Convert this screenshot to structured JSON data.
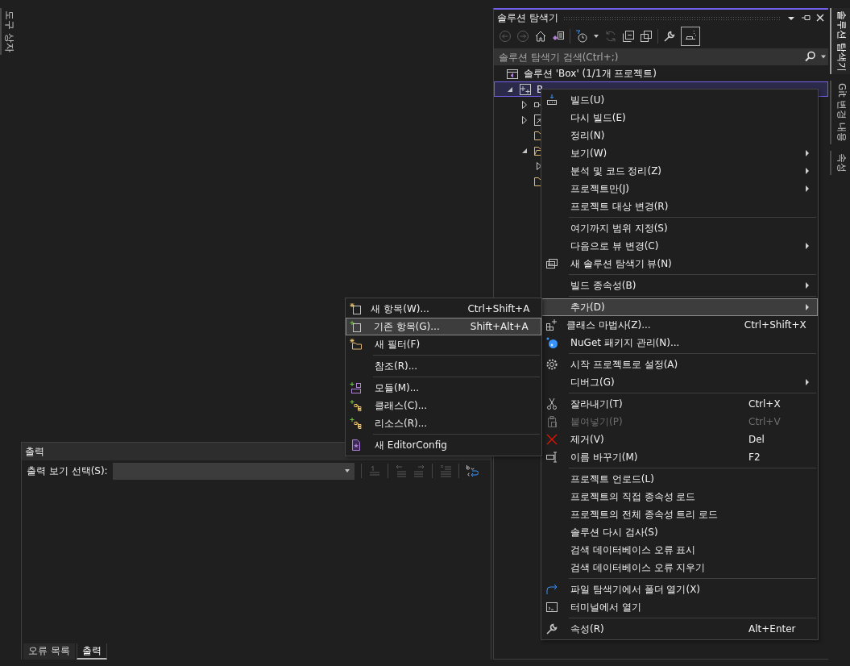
{
  "tool_strip": {
    "tabs": [
      {
        "label": "도구 상자",
        "selected": false
      }
    ]
  },
  "output": {
    "title": "출력",
    "source_label": "출력 보기 선택(S):",
    "toolbar": [
      [
        {
          "disabled": true
        }
      ],
      [
        {
          "disabled": true
        },
        {
          "disabled": true
        }
      ],
      [
        {
          "disabled": true
        }
      ],
      [
        {
          "disabled": false
        }
      ]
    ],
    "tabs": [
      {
        "label": "오류 목록",
        "selected": false
      },
      {
        "label": "출력",
        "selected": true
      }
    ]
  },
  "solution_explorer": {
    "title": "솔루션 탐색기",
    "toolbar": [
      [
        {
          "disabled": true,
          "on": false
        },
        {
          "disabled": true,
          "on": false
        },
        {
          "disabled": false,
          "on": false
        },
        {
          "disabled": false,
          "on": false
        }
      ],
      [
        {
          "disabled": false,
          "on": false
        },
        {
          "disabled": true,
          "on": false
        },
        {
          "disabled": false,
          "on": false
        },
        {
          "disabled": false,
          "on": false
        }
      ],
      [
        {
          "disabled": false,
          "on": false
        },
        {
          "disabled": false,
          "on": true
        }
      ]
    ],
    "search": {
      "placeholder": "솔루션 탐색기 검색(Ctrl+;)"
    },
    "tree": [
      {
        "kind": "solution",
        "label": "솔루션 'Box' (1/1개 프로젝트)",
        "selected": false
      },
      {
        "kind": "project",
        "label": "B",
        "expanded": true,
        "selected": true,
        "children": [
          {
            "kind": "references",
            "expanded": false,
            "selected": false
          },
          {
            "kind": "external",
            "expanded": false,
            "selected": false
          },
          {
            "kind": "folder",
            "selected": false
          },
          {
            "kind": "folder-open",
            "expanded": true,
            "selected": false,
            "children": [
              {
                "expanded": false,
                "selected": false
              }
            ]
          },
          {
            "kind": "folder",
            "selected": false
          }
        ]
      }
    ]
  },
  "side_tabs": [
    {
      "label": "솔루션 탐색기",
      "selected": true
    },
    {
      "label": "Git 변경 내용",
      "selected": false
    },
    {
      "label": "속성",
      "selected": false
    }
  ],
  "context_menu": {
    "groups": [
      [
        {
          "label": "빌드(U)",
          "submenu": false,
          "disabled": false,
          "selected": false
        },
        {
          "label": "다시 빌드(E)",
          "submenu": false,
          "disabled": false,
          "selected": false
        },
        {
          "label": "정리(N)",
          "submenu": false,
          "disabled": false,
          "selected": false
        },
        {
          "label": "보기(W)",
          "submenu": true,
          "disabled": false,
          "selected": false
        },
        {
          "label": "분석 및 코드 정리(Z)",
          "submenu": true,
          "disabled": false,
          "selected": false
        },
        {
          "label": "프로젝트만(J)",
          "submenu": true,
          "disabled": false,
          "selected": false
        },
        {
          "label": "프로젝트 대상 변경(R)",
          "submenu": false,
          "disabled": false,
          "selected": false
        }
      ],
      [
        {
          "label": "여기까지 범위 지정(S)",
          "submenu": false,
          "disabled": false,
          "selected": false
        },
        {
          "label": "다음으로 뷰 변경(C)",
          "submenu": true,
          "disabled": false,
          "selected": false
        },
        {
          "label": "새 솔루션 탐색기 뷰(N)",
          "submenu": false,
          "disabled": false,
          "selected": false
        }
      ],
      [
        {
          "label": "빌드 종속성(B)",
          "submenu": true,
          "disabled": false,
          "selected": false
        }
      ],
      [
        {
          "label": "추가(D)",
          "submenu": true,
          "disabled": false,
          "selected": true
        },
        {
          "label": "클래스 마법사(Z)...",
          "shortcut": "Ctrl+Shift+X",
          "submenu": false,
          "disabled": false,
          "selected": false
        },
        {
          "label": "NuGet 패키지 관리(N)...",
          "submenu": false,
          "disabled": false,
          "selected": false
        }
      ],
      [
        {
          "label": "시작 프로젝트로 설정(A)",
          "submenu": false,
          "disabled": false,
          "selected": false
        },
        {
          "label": "디버그(G)",
          "submenu": true,
          "disabled": false,
          "selected": false
        }
      ],
      [
        {
          "label": "잘라내기(T)",
          "shortcut": "Ctrl+X",
          "submenu": false,
          "disabled": false,
          "selected": false
        },
        {
          "label": "붙여넣기(P)",
          "shortcut": "Ctrl+V",
          "submenu": false,
          "disabled": true,
          "selected": false
        },
        {
          "label": "제거(V)",
          "shortcut": "Del",
          "submenu": false,
          "disabled": false,
          "selected": false
        },
        {
          "label": "이름 바꾸기(M)",
          "shortcut": "F2",
          "submenu": false,
          "disabled": false,
          "selected": false
        }
      ],
      [
        {
          "label": "프로젝트 언로드(L)",
          "submenu": false,
          "disabled": false,
          "selected": false
        },
        {
          "label": "프로젝트의 직접 종속성 로드",
          "submenu": false,
          "disabled": false,
          "selected": false
        },
        {
          "label": "프로젝트의 전체 종속성 트리 로드",
          "submenu": false,
          "disabled": false,
          "selected": false
        },
        {
          "label": "솔루션 다시 검사(S)",
          "submenu": false,
          "disabled": false,
          "selected": false
        },
        {
          "label": "검색 데이터베이스 오류 표시",
          "submenu": false,
          "disabled": false,
          "selected": false
        },
        {
          "label": "검색 데이터베이스 오류 지우기",
          "submenu": false,
          "disabled": false,
          "selected": false
        }
      ],
      [
        {
          "label": "파일 탐색기에서 폴더 열기(X)",
          "submenu": false,
          "disabled": false,
          "selected": false
        },
        {
          "label": "터미널에서 열기",
          "submenu": false,
          "disabled": false,
          "selected": false
        }
      ],
      [
        {
          "label": "속성(R)",
          "shortcut": "Alt+Enter",
          "submenu": false,
          "disabled": false,
          "selected": false
        }
      ]
    ]
  },
  "add_submenu": {
    "groups": [
      [
        {
          "label": "새 항목(W)...",
          "shortcut": "Ctrl+Shift+A",
          "submenu": false,
          "disabled": false,
          "selected": false
        },
        {
          "label": "기존 항목(G)...",
          "shortcut": "Shift+Alt+A",
          "submenu": false,
          "disabled": false,
          "selected": true
        },
        {
          "label": "새 필터(F)",
          "submenu": false,
          "disabled": false,
          "selected": false
        }
      ],
      [
        {
          "label": "참조(R)...",
          "submenu": false,
          "disabled": false,
          "selected": false
        }
      ],
      [
        {
          "label": "모듈(M)...",
          "submenu": false,
          "disabled": false,
          "selected": false
        },
        {
          "label": "클래스(C)...",
          "submenu": false,
          "disabled": false,
          "selected": false
        },
        {
          "label": "리소스(R)...",
          "submenu": false,
          "disabled": false,
          "selected": false
        }
      ],
      [
        {
          "label": "새 EditorConfig",
          "submenu": false,
          "disabled": false,
          "selected": false
        }
      ]
    ]
  }
}
